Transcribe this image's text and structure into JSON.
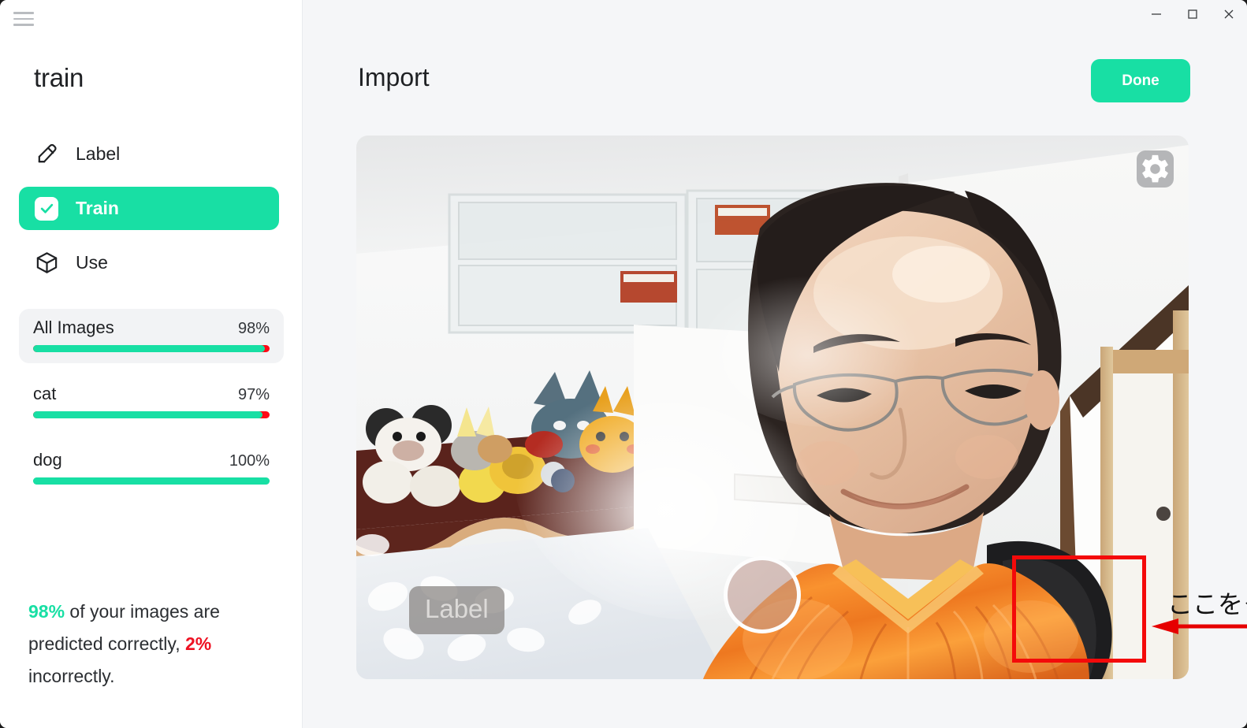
{
  "window": {
    "controls": [
      {
        "name": "minimize",
        "glyph": "minimize-icon"
      },
      {
        "name": "maximize",
        "glyph": "maximize-icon"
      },
      {
        "name": "close",
        "glyph": "close-icon"
      }
    ]
  },
  "sidebar": {
    "menu_icon": "hamburger-icon",
    "project_title": "train",
    "nav": [
      {
        "label": "Label",
        "icon": "pencil-square-icon",
        "active": false
      },
      {
        "label": "Train",
        "icon": "checkbox-checked-icon",
        "active": true
      },
      {
        "label": "Use",
        "icon": "cube-icon",
        "active": false
      }
    ],
    "progress": [
      {
        "name": "All Images",
        "percent_label": "98%",
        "percent": 98,
        "highlight": true
      },
      {
        "name": "cat",
        "percent_label": "97%",
        "percent": 97,
        "highlight": false
      },
      {
        "name": "dog",
        "percent_label": "100%",
        "percent": 100,
        "highlight": false
      }
    ],
    "summary": {
      "correct_pct": "98%",
      "middle_text": " of your images are predicted correctly, ",
      "incorrect_pct": "2%",
      "tail_text": " incorrectly."
    }
  },
  "main": {
    "title": "Import",
    "done_label": "Done",
    "viewport": {
      "gear_icon": "gear-icon",
      "label_chip": "Label",
      "capture_button": "capture-shutter-button"
    },
    "annotation": {
      "text": "ここをクリック、で撮影",
      "box_color": "#f40a0a",
      "arrow_color": "#e60000"
    }
  },
  "colors": {
    "accent_green": "#18dfa4",
    "error_red": "#ee1122",
    "sidebar_bg": "#ffffff",
    "main_bg": "#f5f6f8",
    "annotation_red": "#f40a0a"
  }
}
